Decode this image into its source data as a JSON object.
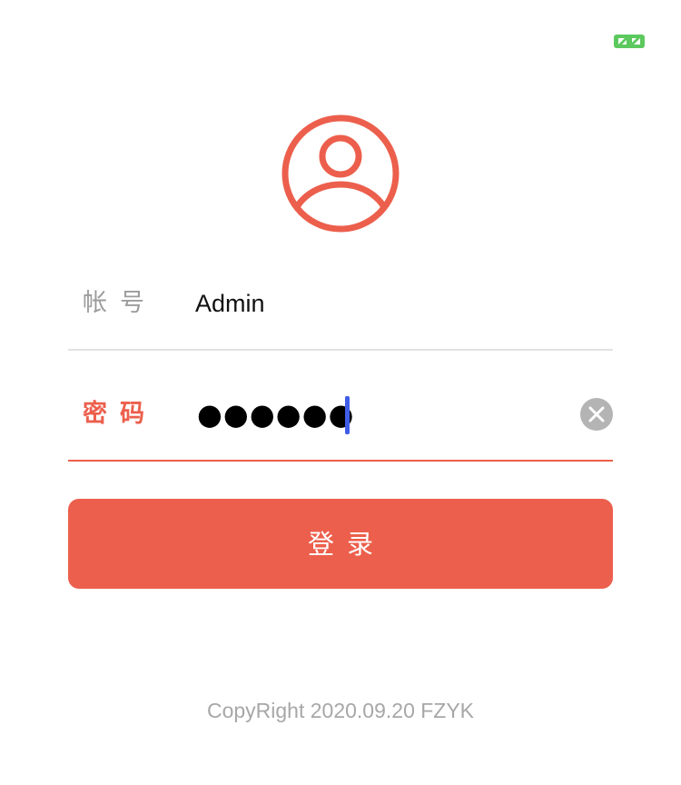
{
  "colors": {
    "accent": "#ec5f4c",
    "label_gray": "#9c9c9c",
    "divider": "#e2e2e2",
    "caret": "#3f5de8",
    "expand_icon": "#5cc95e",
    "clear_icon": "#b4b4b4"
  },
  "header": {
    "expand_icon": "expand-icon"
  },
  "avatar": {
    "icon": "user-icon"
  },
  "account": {
    "label": "帐号",
    "value": "Admin"
  },
  "password": {
    "label": "密码",
    "masked_value": "●●●●●●",
    "clear_icon": "close-icon"
  },
  "login_button": {
    "label": "登录"
  },
  "footer": {
    "copyright": "CopyRight 2020.09.20 FZYK"
  }
}
